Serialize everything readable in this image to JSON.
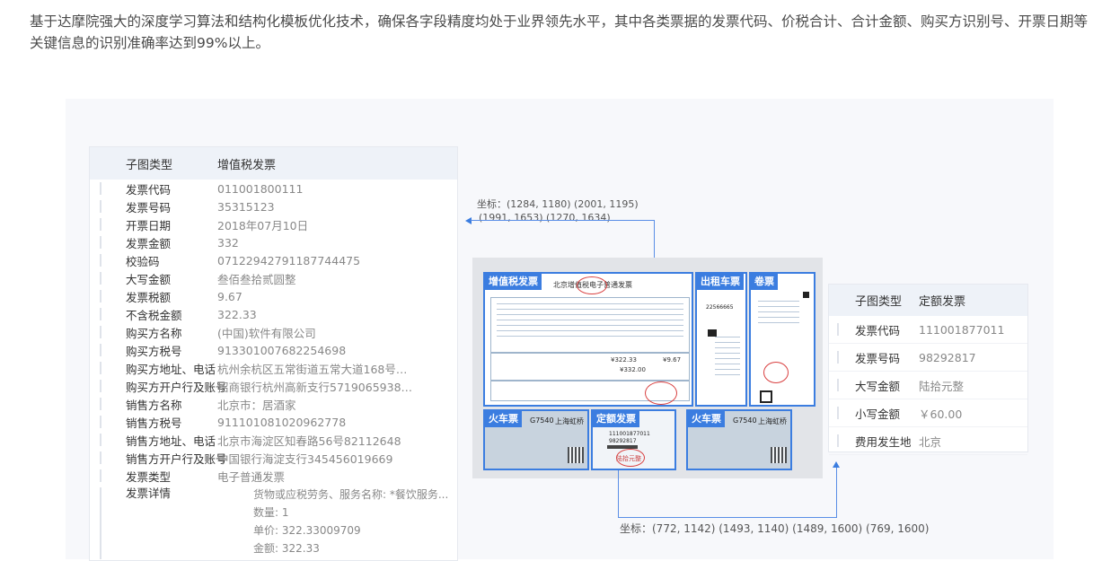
{
  "intro": "基于达摩院强大的深度学习算法和结构化模板优化技术，确保各字段精度均处于业界领先水平，其中各类票据的发票代码、价税合计、合计金额、购买方识别号、开票日期等关键信息的识别准确率达到99%以上。",
  "left_table": {
    "header": {
      "key": "子图类型",
      "value": "增值税发票"
    },
    "rows": [
      {
        "key": "发票代码",
        "value": "011001800111"
      },
      {
        "key": "发票号码",
        "value": "35315123"
      },
      {
        "key": "开票日期",
        "value": "2018年07月10日"
      },
      {
        "key": "发票金额",
        "value": "332"
      },
      {
        "key": "校验码",
        "value": "07122942791187744475"
      },
      {
        "key": "大写金额",
        "value": "叁佰叁拾贰圆整"
      },
      {
        "key": "发票税额",
        "value": "9.67"
      },
      {
        "key": "不含税金额",
        "value": "322.33"
      },
      {
        "key": "购买方名称",
        "value": "(中国)软件有限公司"
      },
      {
        "key": "购买方税号",
        "value": "913301007682254698"
      },
      {
        "key": "购买方地址、电话",
        "value": "杭州余杭区五常街道五常大道168号二..."
      },
      {
        "key": "购买方开户行及账号",
        "value": "招商银行杭州高新支行571906593810..."
      },
      {
        "key": "销售方名称",
        "value": "北京市：居酒家"
      },
      {
        "key": "销售方税号",
        "value": "911101081020962778"
      },
      {
        "key": "销售方地址、电话",
        "value": "北京市海淀区知春路56号82112648"
      },
      {
        "key": "销售方开户行及账号",
        "value": "中国银行海淀支行345456019669"
      },
      {
        "key": "发票类型",
        "value": "电子普通发票"
      }
    ],
    "detail": {
      "key": "发票详情",
      "lines": [
        "货物或应税劳务、服务名称: *餐饮服务...",
        "数量: 1",
        "单价: 322.33009709",
        "金额: 322.33"
      ]
    }
  },
  "coords_top": [
    "坐标：(1284, 1180) (2001, 1195)",
    "(1991, 1653) (1270, 1634)"
  ],
  "coords_bottom": "坐标：(772, 1142) (1493, 1140) (1489, 1600) (769, 1600)",
  "invoices": {
    "vat": {
      "tag": "增值税发票",
      "title": "北京增值税电子普通发票",
      "amount1": "¥322.33",
      "amount2": "¥332.00",
      "tax": "¥9.67"
    },
    "taxi": {
      "tag": "出租车票",
      "code": "22566665"
    },
    "roll": {
      "tag": "卷票"
    },
    "train1": {
      "tag": "火车票",
      "train": "G7540",
      "station": "上海虹桥"
    },
    "quota": {
      "tag": "定额发票",
      "code": "111001877011",
      "number": "98292817",
      "amount": "陆拾元整"
    },
    "train2": {
      "tag": "火车票",
      "train": "G7540",
      "station": "上海虹桥"
    }
  },
  "right_table": {
    "header": {
      "key": "子图类型",
      "value": "定额发票"
    },
    "rows": [
      {
        "key": "发票代码",
        "value": "111001877011"
      },
      {
        "key": "发票号码",
        "value": "98292817"
      },
      {
        "key": "大写金额",
        "value": "陆拾元整"
      },
      {
        "key": "小写金额",
        "value": "￥60.00"
      },
      {
        "key": "费用发生地",
        "value": "北京"
      }
    ]
  }
}
